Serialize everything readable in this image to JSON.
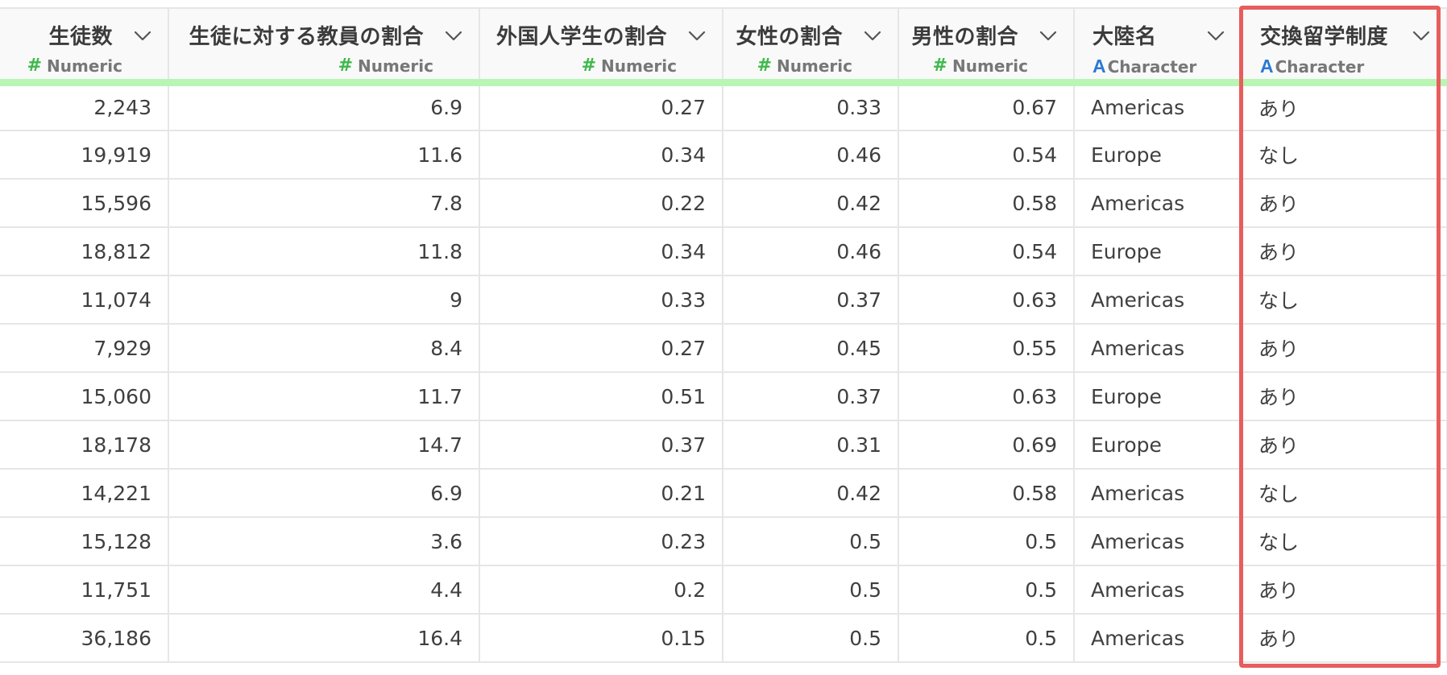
{
  "columns": [
    {
      "name": "生徒数",
      "type": "Numeric",
      "icon": "numeric-type-icon"
    },
    {
      "name": "生徒に対する教員の割合",
      "type": "Numeric",
      "icon": "numeric-type-icon"
    },
    {
      "name": "外国人学生の割合",
      "type": "Numeric",
      "icon": "numeric-type-icon"
    },
    {
      "name": "女性の割合",
      "type": "Numeric",
      "icon": "numeric-type-icon"
    },
    {
      "name": "男性の割合",
      "type": "Numeric",
      "icon": "numeric-type-icon"
    },
    {
      "name": "大陸名",
      "type": "Character",
      "icon": "character-type-icon"
    },
    {
      "name": "交換留学制度",
      "type": "Character",
      "icon": "character-type-icon"
    }
  ],
  "type_glyphs": {
    "numeric": "#",
    "character": "A"
  },
  "rows": [
    [
      "2,243",
      "6.9",
      "0.27",
      "0.33",
      "0.67",
      "Americas",
      "あり"
    ],
    [
      "19,919",
      "11.6",
      "0.34",
      "0.46",
      "0.54",
      "Europe",
      "なし"
    ],
    [
      "15,596",
      "7.8",
      "0.22",
      "0.42",
      "0.58",
      "Americas",
      "あり"
    ],
    [
      "18,812",
      "11.8",
      "0.34",
      "0.46",
      "0.54",
      "Europe",
      "あり"
    ],
    [
      "11,074",
      "9",
      "0.33",
      "0.37",
      "0.63",
      "Americas",
      "なし"
    ],
    [
      "7,929",
      "8.4",
      "0.27",
      "0.45",
      "0.55",
      "Americas",
      "あり"
    ],
    [
      "15,060",
      "11.7",
      "0.51",
      "0.37",
      "0.63",
      "Europe",
      "あり"
    ],
    [
      "18,178",
      "14.7",
      "0.37",
      "0.31",
      "0.69",
      "Europe",
      "あり"
    ],
    [
      "14,221",
      "6.9",
      "0.21",
      "0.42",
      "0.58",
      "Americas",
      "なし"
    ],
    [
      "15,128",
      "3.6",
      "0.23",
      "0.5",
      "0.5",
      "Americas",
      "なし"
    ],
    [
      "11,751",
      "4.4",
      "0.2",
      "0.5",
      "0.5",
      "Americas",
      "あり"
    ],
    [
      "36,186",
      "16.4",
      "0.15",
      "0.5",
      "0.5",
      "Americas",
      "あり"
    ]
  ],
  "colors": {
    "numeric_icon": "#3fb84a",
    "character_icon": "#2a7ad4",
    "header_underline": "#b9f5b5",
    "selection_border": "#e85d5d"
  },
  "selected_column": "交換留学制度"
}
